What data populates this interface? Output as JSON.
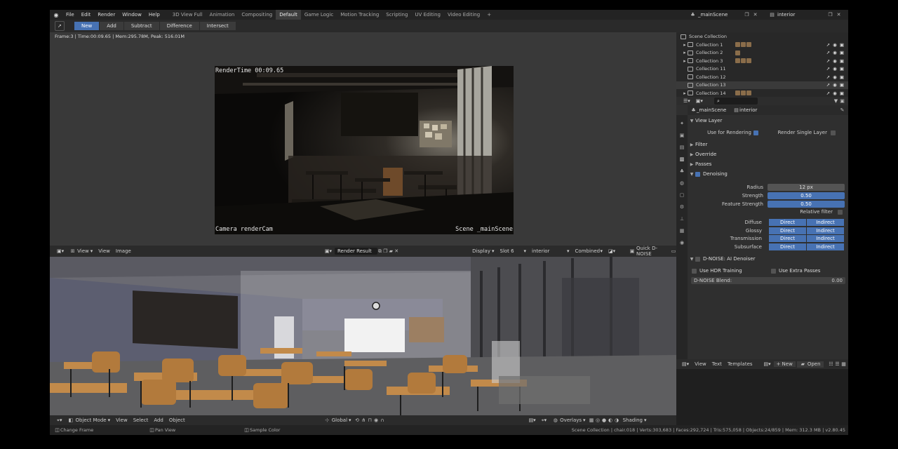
{
  "topbar": {
    "menus": [
      "File",
      "Edit",
      "Render",
      "Window",
      "Help"
    ],
    "workspaces": [
      "3D View Full",
      "Animation",
      "Compositing",
      "Default",
      "Game Logic",
      "Motion Tracking",
      "Scripting",
      "UV Editing",
      "Video Editing"
    ],
    "active_workspace": "Default",
    "add_tab": "+",
    "scene": "_mainScene",
    "view_layer": "interior"
  },
  "toolheader": {
    "modes": [
      "New",
      "Add",
      "Subtract",
      "Difference",
      "Intersect"
    ],
    "active_mode": "New"
  },
  "image_editor": {
    "info_line": "Frame:3 | Time:00:09.65 | Mem:295.78M, Peak: 516.01M",
    "render_time": "RenderTime 00:09.65",
    "camera_label": "Camera renderCam",
    "scene_label": "Scene _mainScene",
    "header": {
      "view_menu": "View",
      "menus": [
        "View",
        "Image"
      ],
      "image_name": "Render Result",
      "display": "Display",
      "slot": "Slot 6",
      "layer": "interior",
      "pass": "Combined",
      "dnoise": "Quick D-NOISE"
    }
  },
  "viewport": {
    "mode": "Object Mode",
    "menus": [
      "View",
      "Select",
      "Add",
      "Object"
    ],
    "transform": "Global",
    "overlays": "Overlays",
    "shading": "Shading"
  },
  "status": {
    "items": [
      "Change Frame",
      "Pan View",
      "Sample Color"
    ],
    "stats": "Scene Collection | chair.018 | Verts:303,683 | Faces:292,724 | Tris:575,058 | Objects:24/859 | Mem: 312.3 MB | v2.80.45"
  },
  "outliner": {
    "root": "Scene Collection",
    "items": [
      {
        "name": "Collection 1",
        "expand": "▸",
        "thumbs": 3,
        "selected": false
      },
      {
        "name": "Collection 2",
        "expand": "▸",
        "thumbs": 1,
        "selected": false
      },
      {
        "name": "Collection 3",
        "expand": "▸",
        "thumbs": 3,
        "selected": false
      },
      {
        "name": "Collection 11",
        "expand": "",
        "thumbs": 0,
        "selected": false
      },
      {
        "name": "Collection 12",
        "expand": "",
        "thumbs": 0,
        "selected": false
      },
      {
        "name": "Collection 13",
        "expand": "",
        "thumbs": 0,
        "selected": true
      },
      {
        "name": "Collection 14",
        "expand": "▸",
        "thumbs": 3,
        "selected": false
      }
    ]
  },
  "properties": {
    "scene": "_mainScene",
    "view_layer": "interior",
    "view_layer_section": "View Layer",
    "use_for_rendering": "Use for Rendering",
    "render_single_layer": "Render Single Layer",
    "sections": [
      "Filter",
      "Override",
      "Passes"
    ],
    "denoising": "Denoising",
    "radius_label": "Radius",
    "radius_value": "12 px",
    "strength_label": "Strength",
    "strength_value": "0.50",
    "feature_strength_label": "Feature Strength",
    "feature_strength_value": "0.50",
    "relative_filter": "Relative filter",
    "passes": [
      {
        "label": "Diffuse",
        "direct": "Direct",
        "indirect": "Indirect"
      },
      {
        "label": "Glossy",
        "direct": "Direct",
        "indirect": "Indirect"
      },
      {
        "label": "Transmission",
        "direct": "Direct",
        "indirect": "Indirect"
      },
      {
        "label": "Subsurface",
        "direct": "Direct",
        "indirect": "Indirect"
      }
    ],
    "dnoise_section": "D-NOISE: AI Denoiser",
    "use_hdr": "Use HDR Training",
    "use_extra": "Use Extra Passes",
    "blend_label": "D-NOISE Blend:",
    "blend_value": "0.00"
  },
  "text_editor": {
    "menus": [
      "View",
      "Text",
      "Templates"
    ],
    "new": "New",
    "open": "Open"
  },
  "colors": {
    "accent": "#4772b3",
    "panel": "#2f2f2f",
    "header": "#2b2b2b"
  }
}
